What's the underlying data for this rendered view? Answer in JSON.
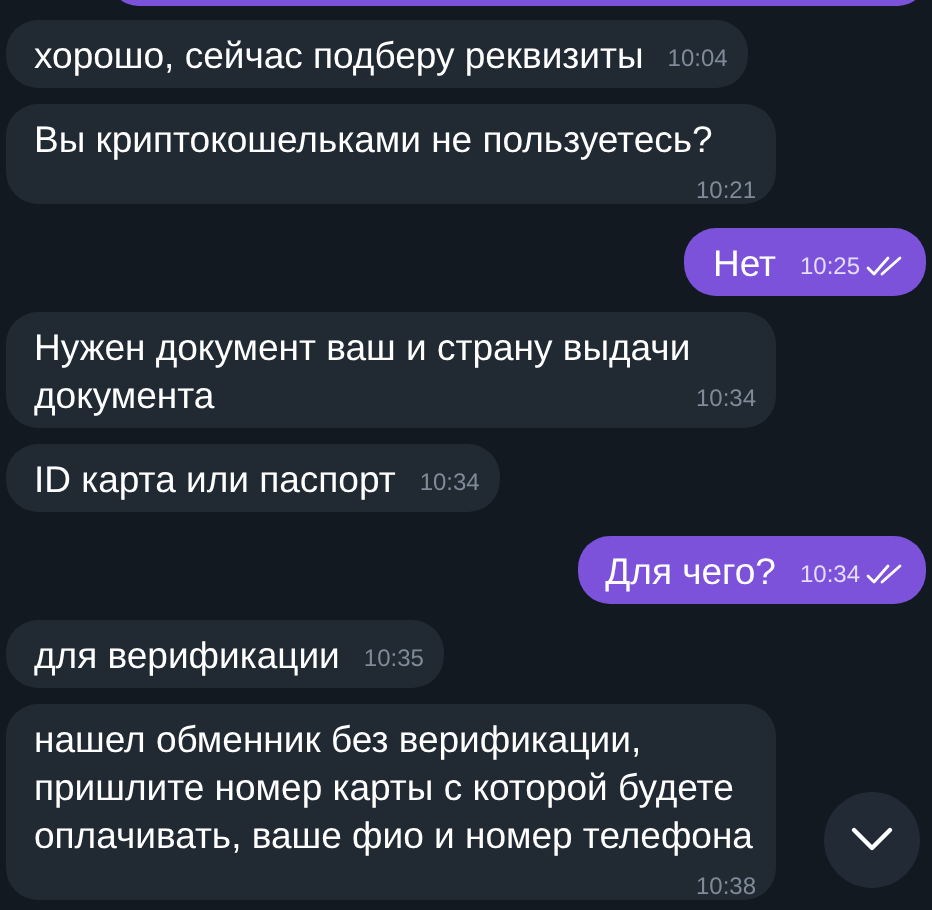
{
  "messages": [
    {
      "kind": "in",
      "text": "хорошо, сейчас подберу реквизиты",
      "time": "10:04"
    },
    {
      "kind": "in",
      "text": "Вы криптокошельками не пользуетесь?",
      "time": "10:21"
    },
    {
      "kind": "out",
      "text": "Нет",
      "time": "10:25",
      "read": true
    },
    {
      "kind": "in",
      "text": "Нужен документ ваш и страну выдачи документа",
      "time": "10:34"
    },
    {
      "kind": "in",
      "text": "ID карта или паспорт",
      "time": "10:34"
    },
    {
      "kind": "out",
      "text": "Для чего?",
      "time": "10:34",
      "read": true
    },
    {
      "kind": "in",
      "text": "для верификации",
      "time": "10:35"
    },
    {
      "kind": "in",
      "text": "нашел обменник без верификации, пришлите номер карты с которой будете оплачивать, ваше фио и номер телефона",
      "time": "10:38"
    }
  ]
}
